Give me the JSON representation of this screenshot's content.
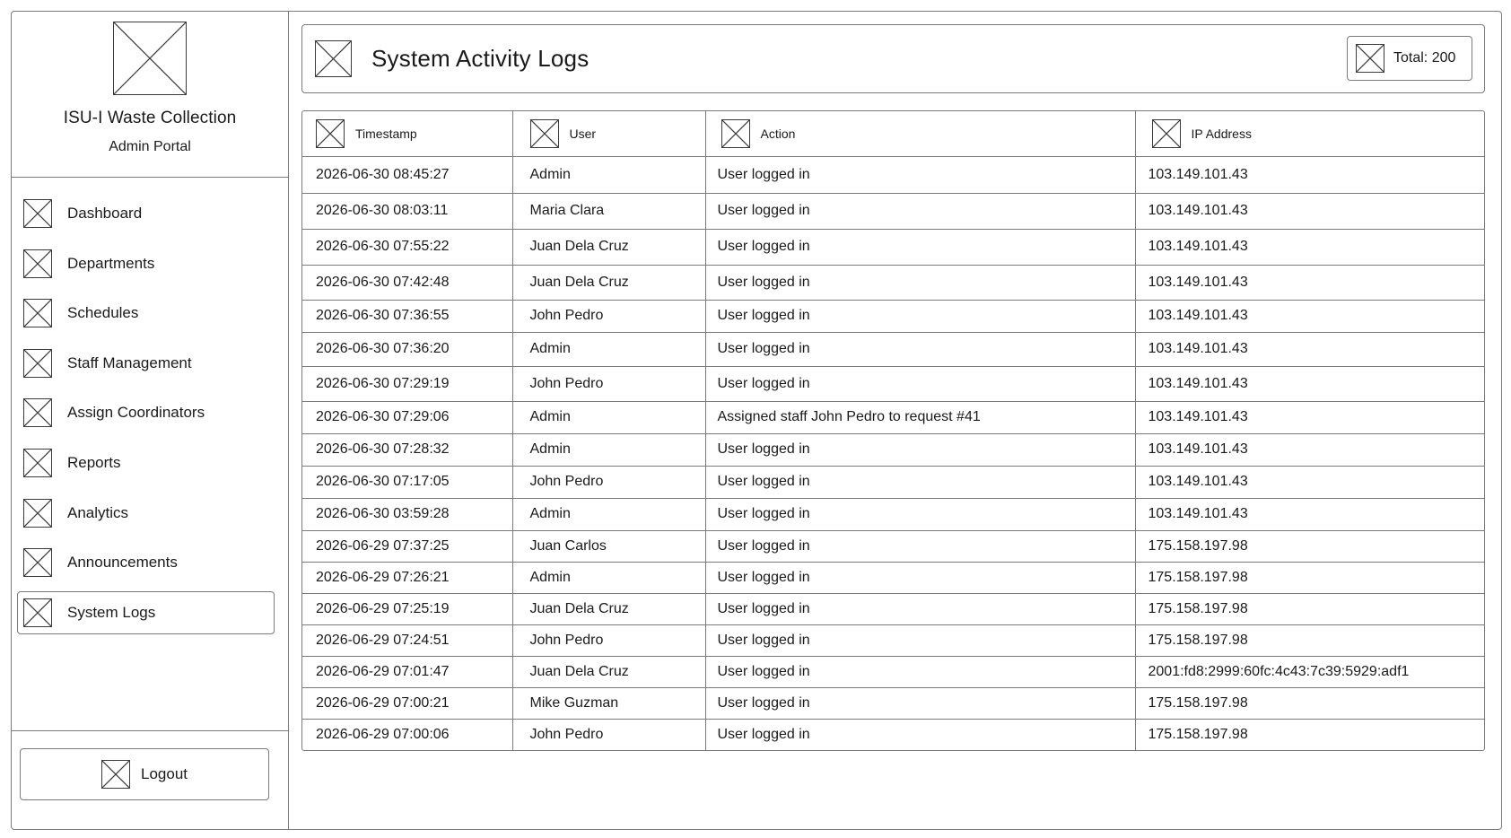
{
  "sidebar": {
    "brand_title": "ISU-I Waste Collection",
    "brand_subtitle": "Admin Portal",
    "logo_icon": "image-placeholder-icon",
    "items": [
      {
        "label": "Dashboard",
        "icon": "image-placeholder-icon",
        "active": false
      },
      {
        "label": "Departments",
        "icon": "image-placeholder-icon",
        "active": false
      },
      {
        "label": "Schedules",
        "icon": "image-placeholder-icon",
        "active": false
      },
      {
        "label": "Staff Management",
        "icon": "image-placeholder-icon",
        "active": false
      },
      {
        "label": "Assign Coordinators",
        "icon": "image-placeholder-icon",
        "active": false
      },
      {
        "label": "Reports",
        "icon": "image-placeholder-icon",
        "active": false
      },
      {
        "label": "Analytics",
        "icon": "image-placeholder-icon",
        "active": false
      },
      {
        "label": "Announcements",
        "icon": "image-placeholder-icon",
        "active": false
      },
      {
        "label": "System Logs",
        "icon": "image-placeholder-icon",
        "active": true
      }
    ],
    "logout_label": "Logout"
  },
  "header": {
    "title": "System Activity Logs",
    "total_label": "Total: 200"
  },
  "table": {
    "columns": [
      "Timestamp",
      "User",
      "Action",
      "IP Address"
    ],
    "rows": [
      [
        "2026-06-30 08:45:27",
        "Admin",
        "User logged in",
        "103.149.101.43"
      ],
      [
        "2026-06-30 08:03:11",
        "Maria Clara",
        "User logged in",
        "103.149.101.43"
      ],
      [
        "2026-06-30 07:55:22",
        "Juan Dela Cruz",
        "User logged in",
        "103.149.101.43"
      ],
      [
        "2026-06-30 07:42:48",
        "Juan Dela Cruz",
        "User logged in",
        "103.149.101.43"
      ],
      [
        "2026-06-30 07:36:55",
        "John Pedro",
        "User logged in",
        "103.149.101.43"
      ],
      [
        "2026-06-30 07:36:20",
        "Admin",
        "User logged in",
        "103.149.101.43"
      ],
      [
        "2026-06-30 07:29:19",
        "John Pedro",
        "User logged in",
        "103.149.101.43"
      ],
      [
        "2026-06-30 07:29:06",
        "Admin",
        "Assigned staff John Pedro to request #41",
        "103.149.101.43"
      ],
      [
        "2026-06-30 07:28:32",
        "Admin",
        "User logged in",
        "103.149.101.43"
      ],
      [
        "2026-06-30 07:17:05",
        "John Pedro",
        "User logged in",
        "103.149.101.43"
      ],
      [
        "2026-06-30 03:59:28",
        "Admin",
        "User logged in",
        "103.149.101.43"
      ],
      [
        "2026-06-29 07:37:25",
        "Juan Carlos",
        "User logged in",
        "175.158.197.98"
      ],
      [
        "2026-06-29 07:26:21",
        "Admin",
        "User logged in",
        "175.158.197.98"
      ],
      [
        "2026-06-29 07:25:19",
        "Juan Dela Cruz",
        "User logged in",
        "175.158.197.98"
      ],
      [
        "2026-06-29 07:24:51",
        "John Pedro",
        "User logged in",
        "175.158.197.98"
      ],
      [
        "2026-06-29 07:01:47",
        "Juan Dela Cruz",
        "User logged in",
        "2001:fd8:2999:60fc:4c43:7c39:5929:adf1"
      ],
      [
        "2026-06-29 07:00:21",
        "Mike Guzman",
        "User logged in",
        "175.158.197.98"
      ],
      [
        "2026-06-29 07:00:06",
        "John Pedro",
        "User logged in",
        "175.158.197.98"
      ]
    ]
  }
}
